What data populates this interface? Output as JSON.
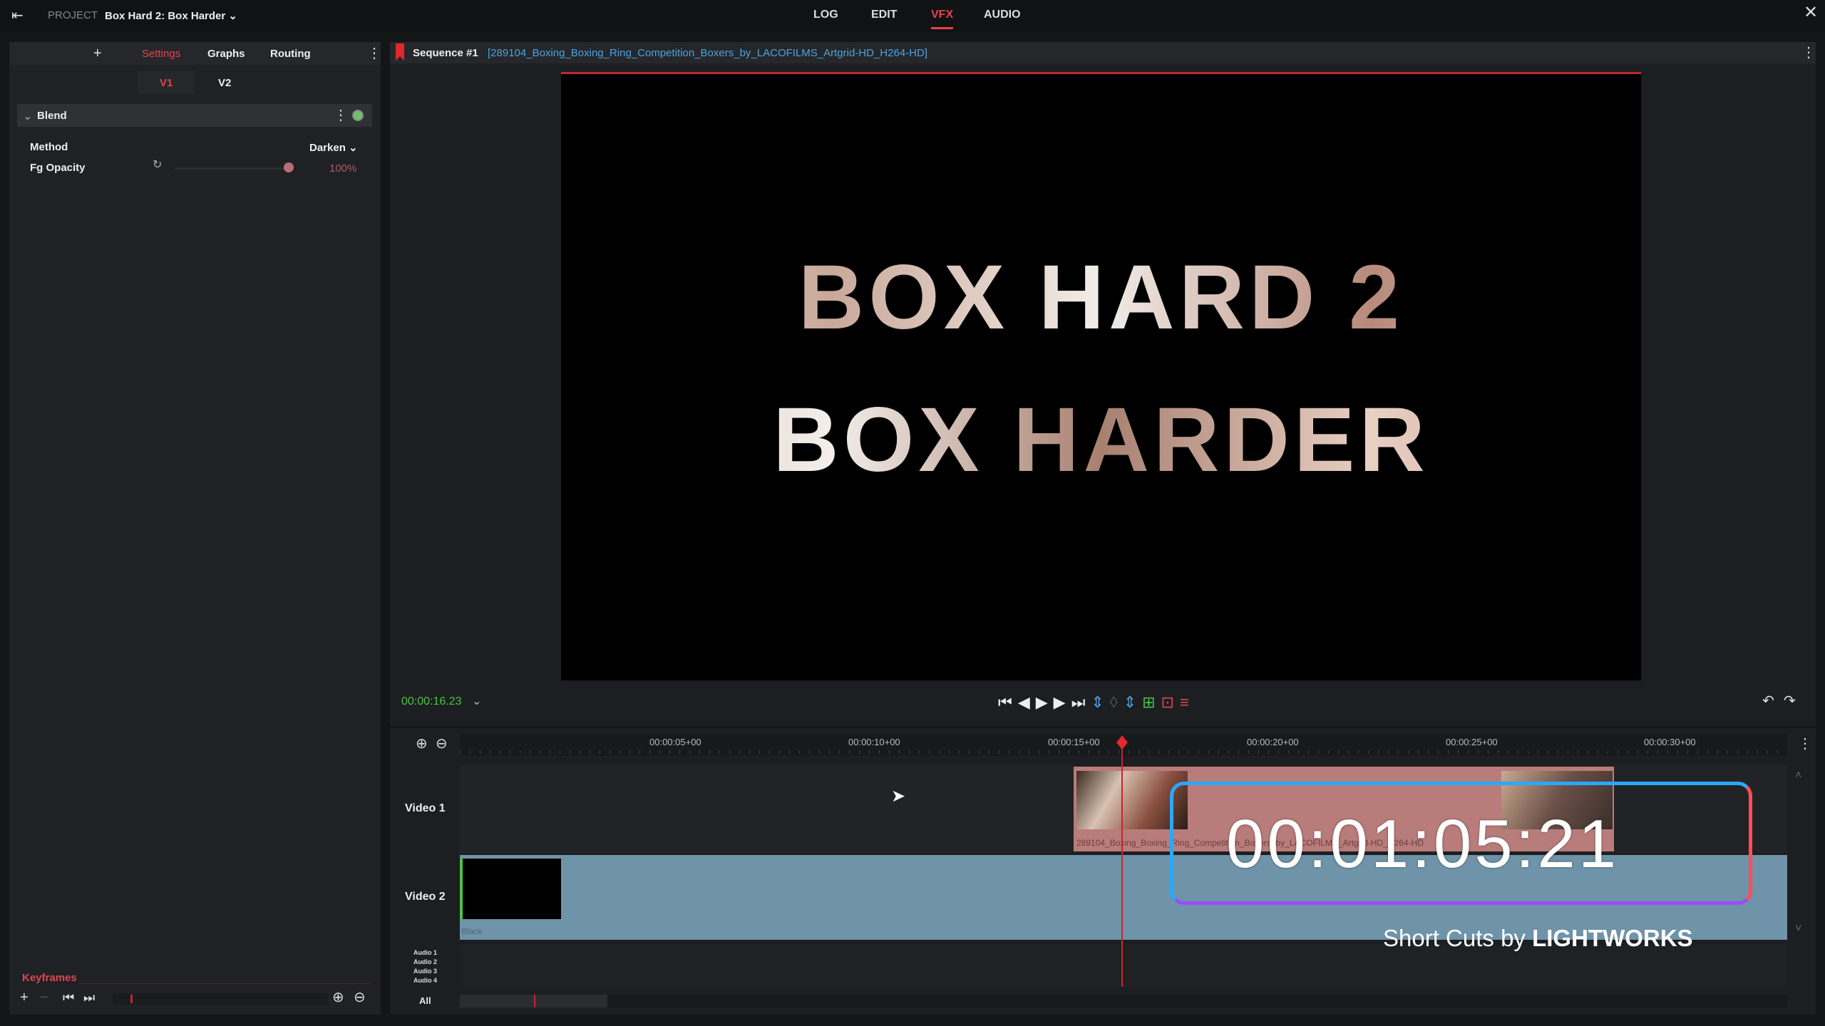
{
  "topbar": {
    "project_label": "PROJECT",
    "project_name": "Box Hard 2: Box Harder",
    "tabs": [
      "LOG",
      "EDIT",
      "VFX",
      "AUDIO"
    ],
    "active_tab": "VFX"
  },
  "effects_panel": {
    "tabs": [
      "Settings",
      "Graphs",
      "Routing"
    ],
    "active_tab": "Settings",
    "layers": [
      "V1",
      "V2"
    ],
    "active_layer": "V1",
    "effect_name": "Blend",
    "params": {
      "method_label": "Method",
      "method_value": "Darken",
      "opacity_label": "Fg Opacity",
      "opacity_value": "100%",
      "opacity_fraction": 1.0
    },
    "keyframes_label": "Keyframes"
  },
  "viewer": {
    "sequence_label": "Sequence #1",
    "clip_name": "[289104_Boxing_Boxing_Ring_Competition_Boxers_by_LACOFILMS_Artgrid-HD_H264-HD]",
    "title_line1": "BOX HARD 2",
    "title_line2": "BOX HARDER",
    "timecode": "00:00:16.23"
  },
  "timeline": {
    "ruler_labels": [
      "00:00:05+00",
      "00:00:10+00",
      "00:00:15+00",
      "00:00:20+00",
      "00:00:25+00",
      "00:00:30+00"
    ],
    "tracks": [
      "Video 1",
      "Video 2"
    ],
    "audio_tracks": [
      "Audio 1",
      "Audio 2",
      "Audio 3",
      "Audio 4"
    ],
    "all_label": "All",
    "clip_v1_name": "289104_Boxing_Boxing_Ring_Competition_Boxers_by_LACOFILMS_Artgrid-HD_H264-HD",
    "clip_v2_name": "Black"
  },
  "overlay": {
    "timecode": "00:01:05:21",
    "brand_prefix": "Short Cuts by",
    "brand_name": "LIGHTWORKS"
  },
  "colors": {
    "accent": "#e0454f",
    "link": "#4aa3e0",
    "green": "#49c443",
    "clip_v1": "#b87c7a",
    "clip_v2": "#6f93a8"
  }
}
